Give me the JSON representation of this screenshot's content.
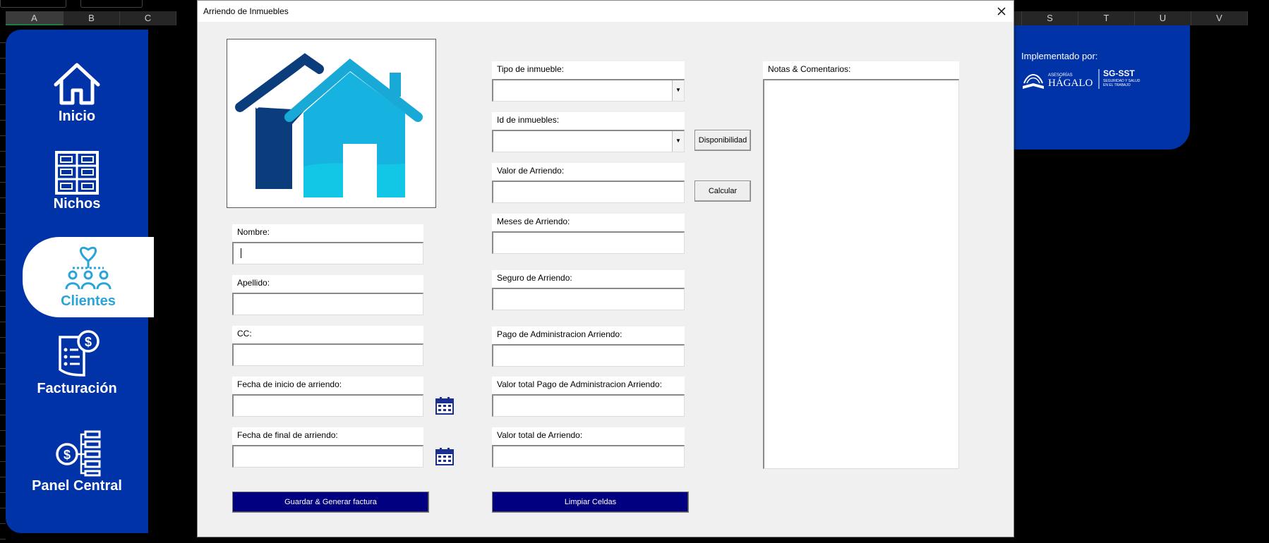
{
  "excel": {
    "columns_left": [
      "A",
      "B",
      "C"
    ],
    "columns_right": [
      "S",
      "T",
      "U",
      "V"
    ],
    "name_box": "..."
  },
  "nav": {
    "items": [
      {
        "label": "Inicio",
        "icon": "home-icon"
      },
      {
        "label": "Nichos",
        "icon": "shelves-icon"
      },
      {
        "label": "Clientes",
        "icon": "clients-network-icon"
      },
      {
        "label": "Facturación",
        "icon": "invoice-icon"
      },
      {
        "label": "Panel Central",
        "icon": "finance-network-icon"
      }
    ],
    "active_index": 2,
    "colors": {
      "panel": "#0033a8",
      "active_text": "#2aa4d8"
    }
  },
  "brand": {
    "title": "Implementado por:",
    "logo_text": "HÁGALO",
    "logo_small": "ASESORÍAS",
    "logo_right": "SG-SST",
    "logo_right_sub1": "SEGURIDAD Y SALUD",
    "logo_right_sub2": "EN EL TRABAJO"
  },
  "dialog": {
    "title": "Arriendo de Inmuebles",
    "left": {
      "nombre_label": "Nombre:",
      "apellido_label": "Apellido:",
      "cc_label": "CC:",
      "fecha_inicio_label": "Fecha de inicio de arriendo:",
      "fecha_final_label": "Fecha de final de arriendo:",
      "nombre_value": "",
      "apellido_value": "",
      "cc_value": "",
      "fecha_inicio_value": "",
      "fecha_final_value": ""
    },
    "middle": {
      "tipo_label": "Tipo de inmueble:",
      "id_label": "Id de inmuebles:",
      "valor_label": "Valor de Arriendo:",
      "meses_label": "Meses de Arriendo:",
      "seguro_label": "Seguro de Arriendo:",
      "pago_admin_label": "Pago de Administracion Arriendo:",
      "valor_total_admin_label": "Valor total Pago de Administracion Arriendo:",
      "valor_total_label": "Valor total de Arriendo:",
      "tipo_value": "",
      "id_value": "",
      "valor_value": "",
      "meses_value": "",
      "seguro_value": "",
      "pago_admin_value": "",
      "valor_total_admin_value": "",
      "valor_total_value": ""
    },
    "buttons": {
      "disponibilidad": "Disponibilidad",
      "calcular": "Calcular",
      "guardar": "Guardar & Generar factura",
      "limpiar": "Limpiar Celdas"
    },
    "notes": {
      "label": "Notas & Comentarios:",
      "value": ""
    }
  }
}
